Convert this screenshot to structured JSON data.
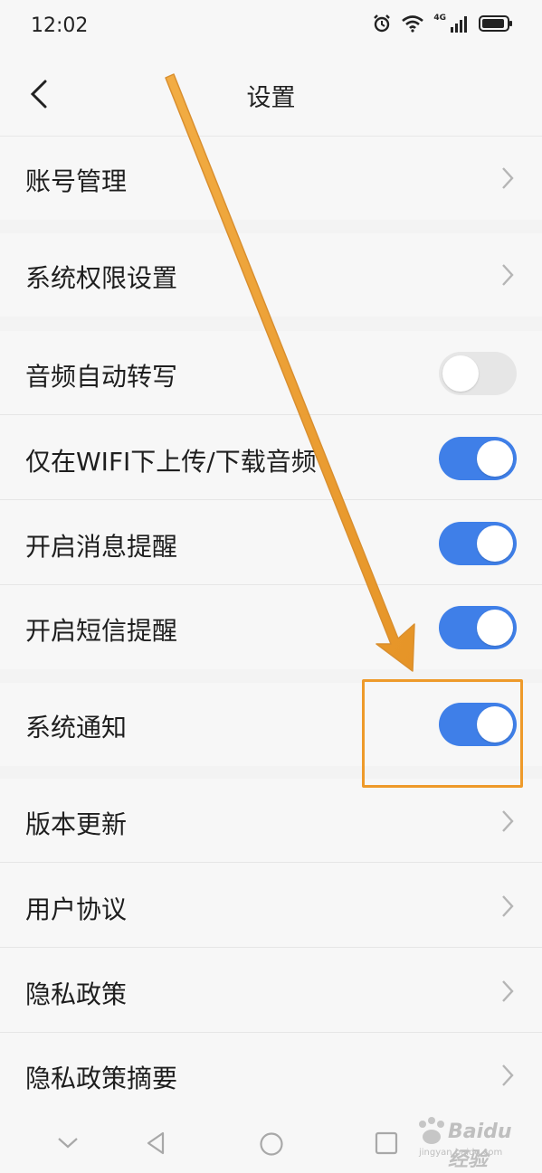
{
  "status_bar": {
    "time": "12:02",
    "network": "4G"
  },
  "header": {
    "title": "设置"
  },
  "settings": {
    "account": "账号管理",
    "permissions": "系统权限设置",
    "audio_transcribe": {
      "label": "音频自动转写",
      "state": "off"
    },
    "wifi_only": {
      "label": "仅在WIFI下上传/下载音频",
      "state": "on"
    },
    "msg_reminder": {
      "label": "开启消息提醒",
      "state": "on"
    },
    "sms_reminder": {
      "label": "开启短信提醒",
      "state": "on"
    },
    "system_notify": {
      "label": "系统通知",
      "state": "on"
    },
    "version": "版本更新",
    "user_agreement": "用户协议",
    "privacy_policy": "隐私政策",
    "privacy_summary": "隐私政策摘要"
  },
  "watermark": {
    "brand": "Baidu 经验",
    "url": "jingyan.baidu.com"
  },
  "colors": {
    "toggle_on": "#3f7fe8",
    "toggle_off": "#e6e6e6",
    "annotation": "#ee9a2a"
  }
}
